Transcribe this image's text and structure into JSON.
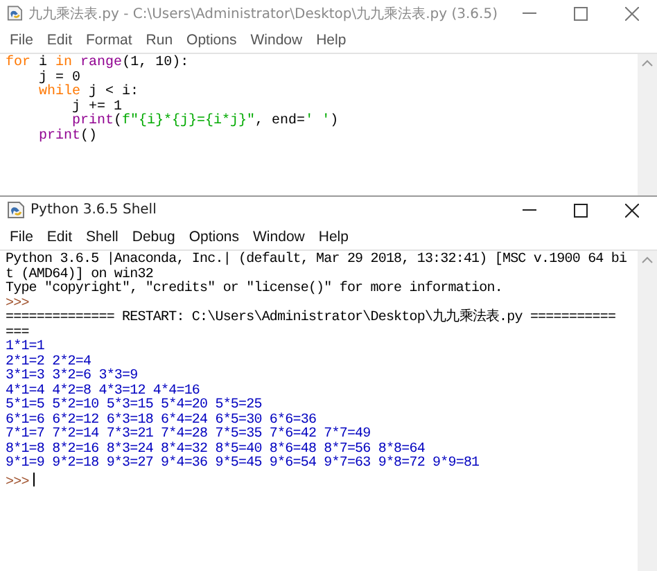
{
  "editor_window": {
    "title": "九九乘法表.py - C:\\Users\\Administrator\\Desktop\\九九乘法表.py (3.6.5)",
    "menu": [
      "File",
      "Edit",
      "Format",
      "Run",
      "Options",
      "Window",
      "Help"
    ],
    "code": [
      [
        {
          "kind": "keyword",
          "text": "for"
        },
        {
          "kind": "plain",
          "text": " i "
        },
        {
          "kind": "keyword",
          "text": "in"
        },
        {
          "kind": "builtin",
          "text": " range"
        },
        {
          "kind": "plain",
          "text": "(1, 10):"
        }
      ],
      [
        {
          "kind": "plain",
          "text": "    j = 0"
        }
      ],
      [
        {
          "kind": "keyword",
          "text": "    while"
        },
        {
          "kind": "plain",
          "text": " j < i:"
        }
      ],
      [
        {
          "kind": "plain",
          "text": "        j += 1"
        }
      ],
      [
        {
          "kind": "builtin",
          "text": "        print"
        },
        {
          "kind": "plain",
          "text": "("
        },
        {
          "kind": "string",
          "text": "f\"{i}*{j}={i*j}\""
        },
        {
          "kind": "plain",
          "text": ", end="
        },
        {
          "kind": "string",
          "text": "' '"
        },
        {
          "kind": "plain",
          "text": ")"
        }
      ],
      [
        {
          "kind": "builtin",
          "text": "    print"
        },
        {
          "kind": "plain",
          "text": "()"
        }
      ]
    ]
  },
  "shell_window": {
    "title": "Python 3.6.5 Shell",
    "menu": [
      "File",
      "Edit",
      "Shell",
      "Debug",
      "Options",
      "Window",
      "Help"
    ],
    "lines": [
      {
        "kind": "banner",
        "text": "Python 3.6.5 |Anaconda, Inc.| (default, Mar 29 2018, 13:32:41) [MSC v.1900 64 bi"
      },
      {
        "kind": "banner",
        "text": "t (AMD64)] on win32"
      },
      {
        "kind": "banner",
        "text": "Type \"copyright\", \"credits\" or \"license()\" for more information."
      },
      {
        "kind": "prompt",
        "text": ">>>"
      },
      {
        "kind": "banner",
        "text": "============== RESTART: C:\\Users\\Administrator\\Desktop\\九九乘法表.py ==========="
      },
      {
        "kind": "banner",
        "text": "==="
      },
      {
        "kind": "output",
        "text": "1*1=1"
      },
      {
        "kind": "output",
        "text": "2*1=2 2*2=4"
      },
      {
        "kind": "output",
        "text": "3*1=3 3*2=6 3*3=9"
      },
      {
        "kind": "output",
        "text": "4*1=4 4*2=8 4*3=12 4*4=16"
      },
      {
        "kind": "output",
        "text": "5*1=5 5*2=10 5*3=15 5*4=20 5*5=25"
      },
      {
        "kind": "output",
        "text": "6*1=6 6*2=12 6*3=18 6*4=24 6*5=30 6*6=36"
      },
      {
        "kind": "output",
        "text": "7*1=7 7*2=14 7*3=21 7*4=28 7*5=35 7*6=42 7*7=49"
      },
      {
        "kind": "output",
        "text": "8*1=8 8*2=16 8*3=24 8*4=32 8*5=40 8*6=48 8*7=56 8*8=64"
      },
      {
        "kind": "output",
        "text": "9*1=9 9*2=18 9*3=27 9*4=36 9*5=45 9*6=54 9*7=63 9*8=72 9*9=81"
      },
      {
        "kind": "input_prompt",
        "text": ">>>"
      }
    ]
  }
}
